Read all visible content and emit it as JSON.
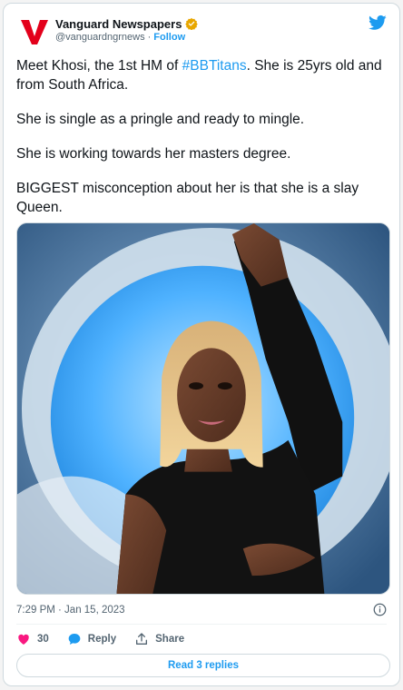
{
  "author": {
    "name": "Vanguard Newspapers",
    "handle": "@vanguardngrnews",
    "separator": "·",
    "follow_label": "Follow",
    "avatar_letter": "V",
    "brand_color": "#e3001b"
  },
  "tweet": {
    "para1_pre": "Meet Khosi, the 1st HM of ",
    "para1_hashtag": "#BBTitans",
    "para1_post": ". She is 25yrs old and from South Africa.",
    "para2": "She is single as a pringle and ready to mingle.",
    "para3": "She is working towards her masters degree.",
    "para4": "BIGGEST misconception about her is that she is a slay Queen."
  },
  "meta": {
    "timestamp": "7:29 PM · Jan 15, 2023"
  },
  "actions": {
    "likes": "30",
    "reply_label": "Reply",
    "share_label": "Share",
    "read_replies_label": "Read 3 replies"
  },
  "icons": {
    "like": "heart-icon",
    "reply": "speech-bubble-icon",
    "share": "share-icon",
    "info": "info-icon",
    "platform": "twitter-bird-icon",
    "verified": "verified-badge-icon"
  },
  "colors": {
    "accent": "#1d9bf0",
    "like": "#f91880",
    "verified": "#e8a700"
  }
}
